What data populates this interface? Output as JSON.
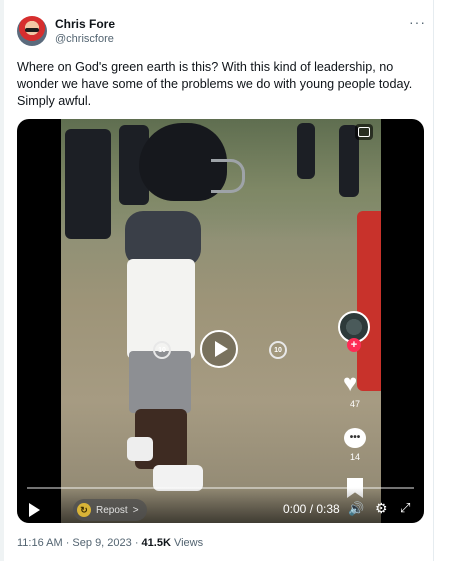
{
  "author": {
    "name": "Chris Fore",
    "handle": "@chriscfore",
    "avatar_icon": "profile-avatar"
  },
  "menu": {
    "more_label": "···"
  },
  "tweet": {
    "text": "Where on God's green earth is this? With this kind of leadership, no wonder we have some of the problems we do with young people today. Simply awful."
  },
  "video": {
    "skip_back_label": "10",
    "skip_forward_label": "10",
    "like_count": "47",
    "comment_count": "14",
    "follow_symbol": "+",
    "repost_label": "Repost",
    "repost_chevron": ">",
    "time_display": "0:00 / 0:38",
    "progress": 0,
    "icons": {
      "play": "play-icon",
      "pip": "picture-in-picture-icon",
      "heart": "heart-icon",
      "comment": "comment-icon",
      "bookmark": "bookmark-icon",
      "volume": "volume-icon",
      "settings": "gear-icon",
      "fullscreen": "expand-icon"
    }
  },
  "meta": {
    "timestamp": "11:16 AM · Sep 9, 2023 ·",
    "views_count": "41.5K",
    "views_label": "Views"
  },
  "colors": {
    "text_primary": "#0f1419",
    "text_secondary": "#536471",
    "follow_red": "#fe2c55"
  }
}
